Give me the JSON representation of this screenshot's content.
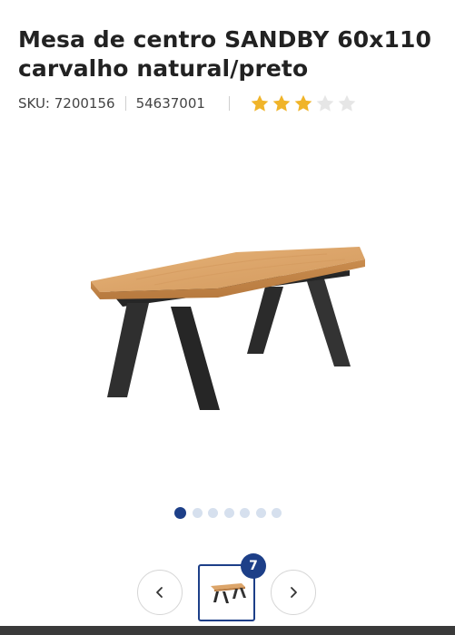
{
  "product": {
    "title": "Mesa de centro SANDBY 60x110 carvalho natural/preto",
    "sku_label": "SKU: 7200156",
    "ref_number": "54637001",
    "rating": 3,
    "rating_max": 5
  },
  "gallery": {
    "image_count": 7,
    "active_index": 0,
    "badge": "7",
    "main_image_icon": "coffee-table-image",
    "prev_icon": "chevron-left-icon",
    "next_icon": "chevron-right-icon"
  },
  "colors": {
    "accent": "#1d3f88",
    "star_filled": "#f0b429",
    "star_empty": "#e6e6e6",
    "dot_inactive": "#d6e0ee"
  }
}
